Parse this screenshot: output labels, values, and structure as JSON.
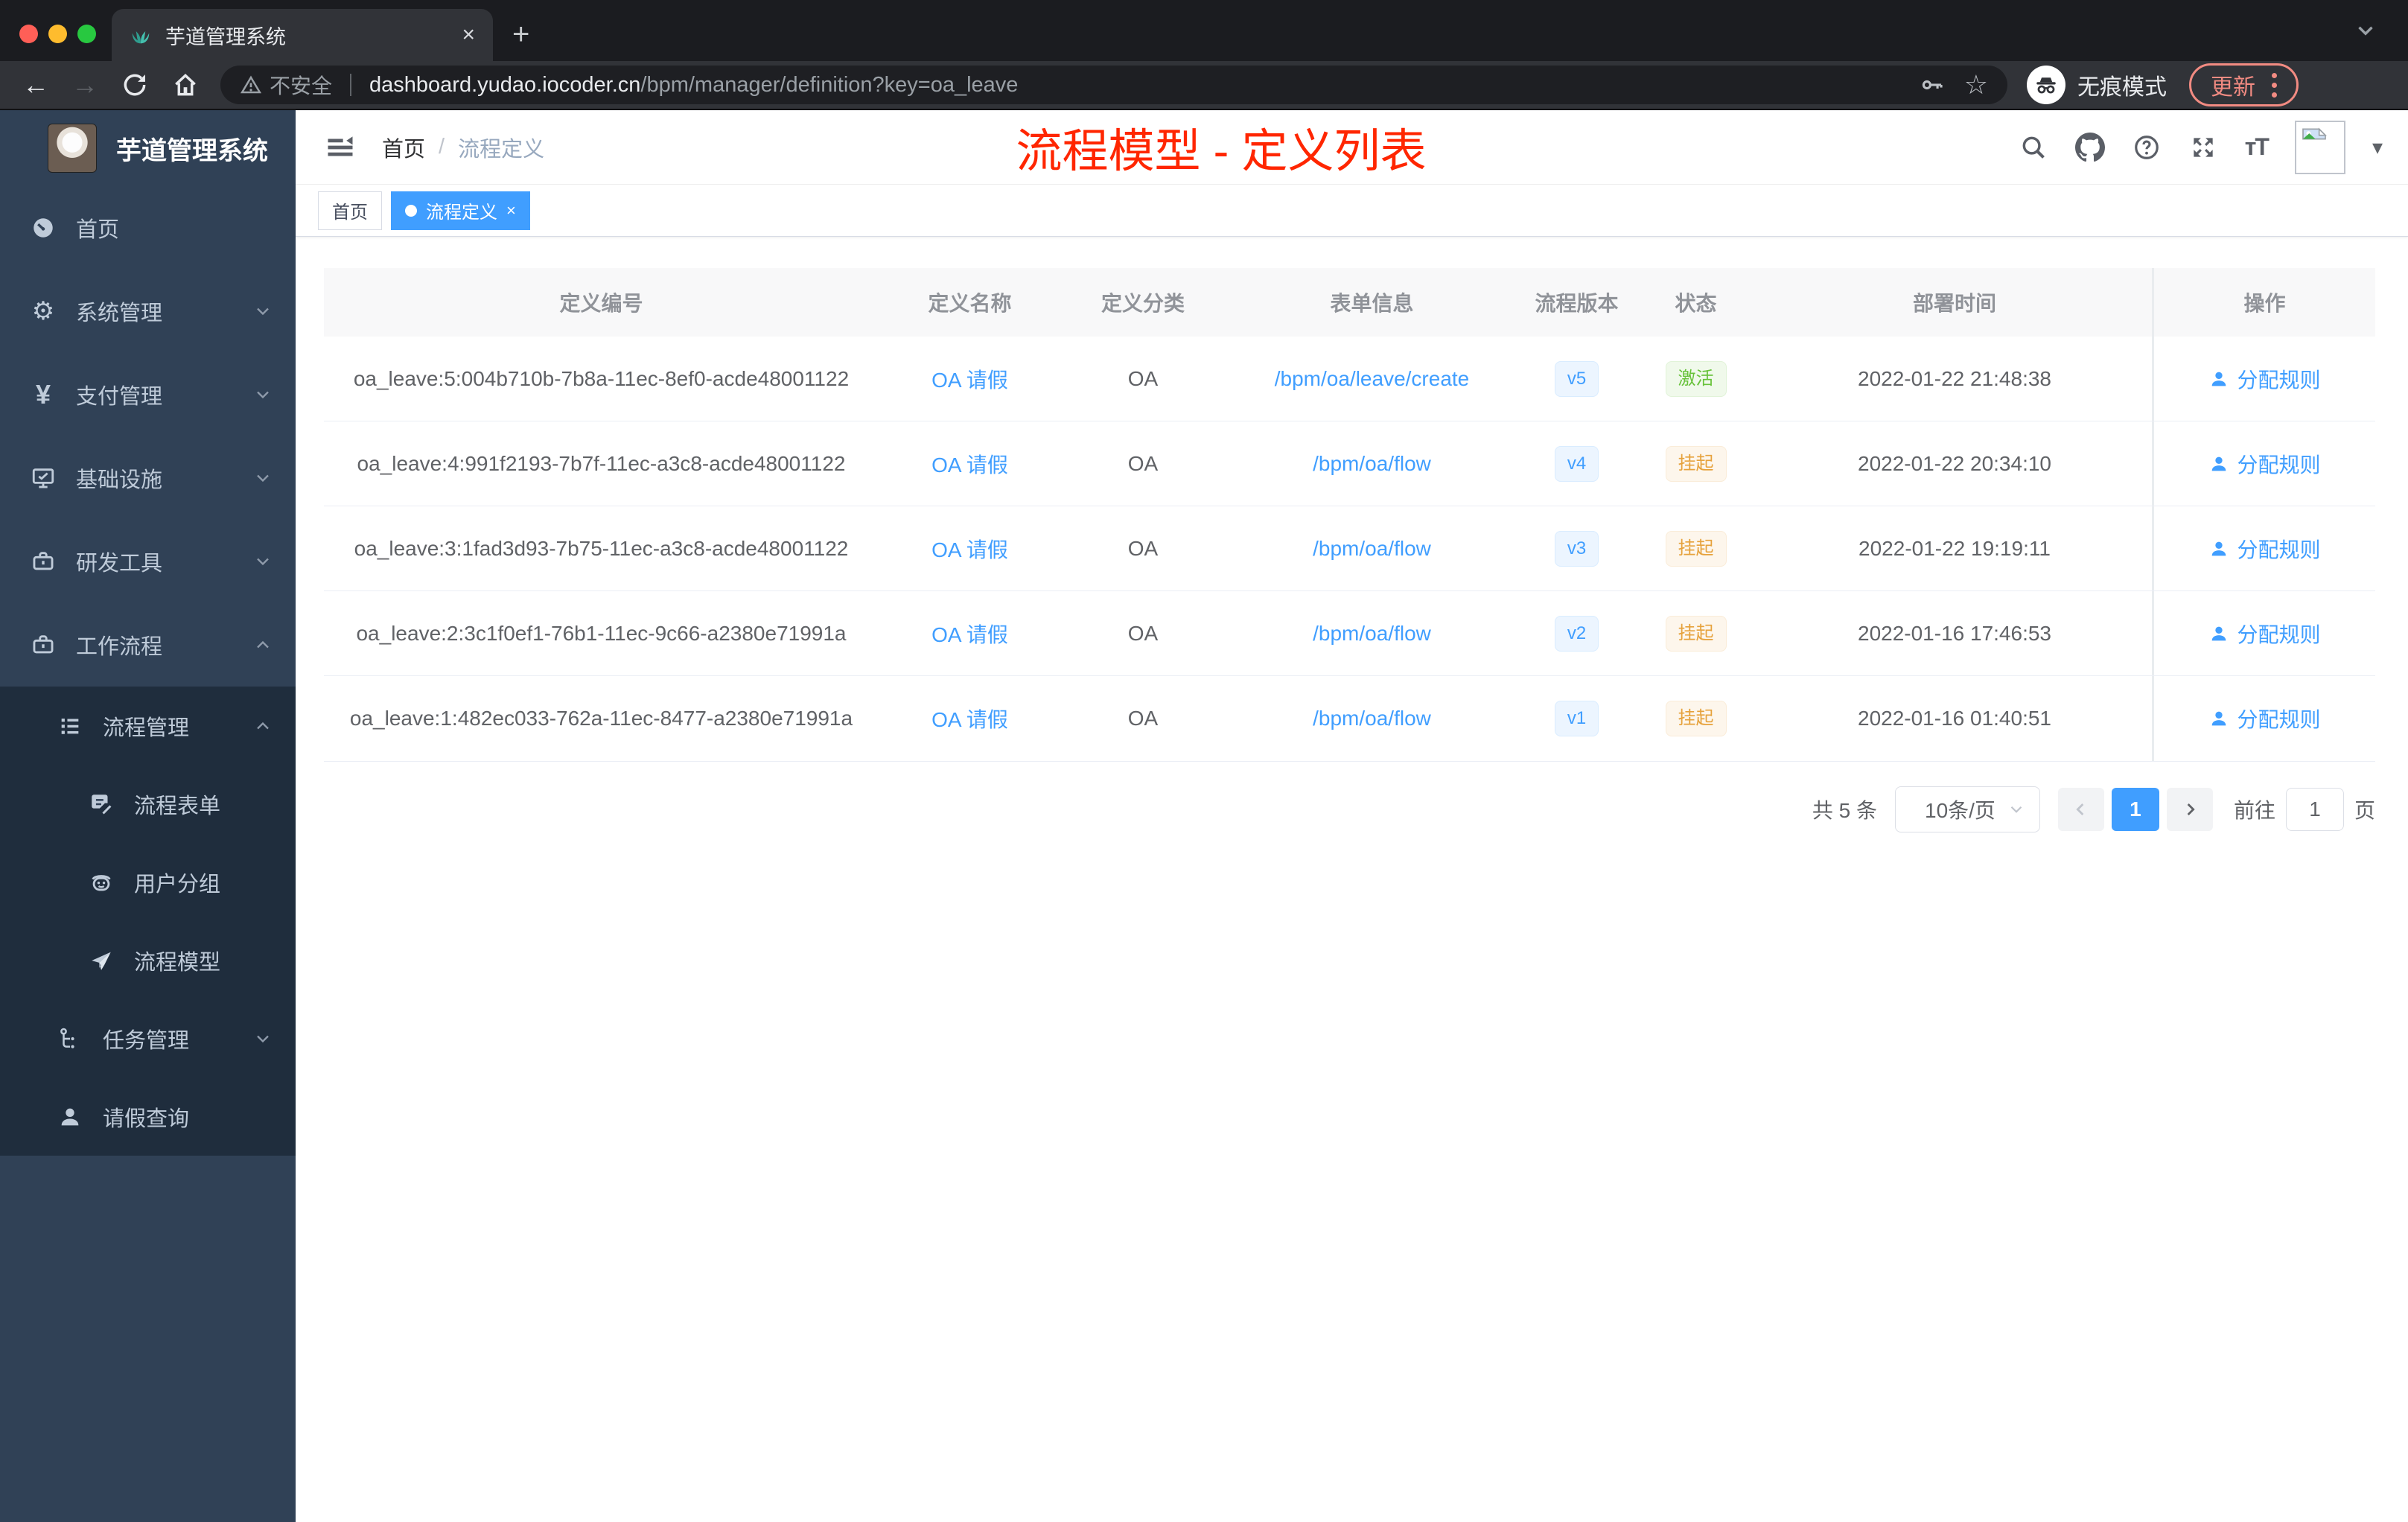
{
  "browser": {
    "tab": {
      "title": "芋道管理系统",
      "close": "×",
      "new_tab": "+"
    },
    "address": {
      "security": "不安全",
      "host": "dashboard.yudao.iocoder.cn",
      "path": "/bpm/manager/definition?key=oa_leave"
    },
    "incognito_label": "无痕模式",
    "update_label": "更新"
  },
  "sidebar": {
    "app_title": "芋道管理系统",
    "items": [
      {
        "label": "首页",
        "icon": "dashboard-icon"
      },
      {
        "label": "系统管理",
        "icon": "gear-icon",
        "chevron": "down"
      },
      {
        "label": "支付管理",
        "icon": "yen-icon",
        "chevron": "down"
      },
      {
        "label": "基础设施",
        "icon": "monitor-icon",
        "chevron": "down"
      },
      {
        "label": "研发工具",
        "icon": "toolbox-icon",
        "chevron": "down"
      },
      {
        "label": "工作流程",
        "icon": "workflow-icon",
        "chevron": "up"
      },
      {
        "label": "流程管理",
        "icon": "list-icon",
        "chevron": "up"
      },
      {
        "label": "流程表单",
        "icon": "form-icon"
      },
      {
        "label": "用户分组",
        "icon": "user-group-icon"
      },
      {
        "label": "流程模型",
        "icon": "paper-plane-icon"
      },
      {
        "label": "任务管理",
        "icon": "task-tree-icon",
        "chevron": "down"
      },
      {
        "label": "请假查询",
        "icon": "person-icon"
      }
    ]
  },
  "header": {
    "breadcrumb": {
      "home": "首页",
      "separator": "/",
      "current": "流程定义"
    },
    "annotation": "流程模型 - 定义列表"
  },
  "tags": {
    "home": "首页",
    "active": "流程定义",
    "close": "×"
  },
  "table": {
    "columns": [
      "定义编号",
      "定义名称",
      "定义分类",
      "表单信息",
      "流程版本",
      "状态",
      "部署时间",
      "操作"
    ],
    "action_label": "分配规则",
    "rows": [
      {
        "id": "oa_leave:5:004b710b-7b8a-11ec-8ef0-acde48001122",
        "name": "OA 请假",
        "category": "OA",
        "form": "/bpm/oa/leave/create",
        "version": "v5",
        "status": "激活",
        "status_type": "success",
        "deploy_time": "2022-01-22 21:48:38"
      },
      {
        "id": "oa_leave:4:991f2193-7b7f-11ec-a3c8-acde48001122",
        "name": "OA 请假",
        "category": "OA",
        "form": "/bpm/oa/flow",
        "version": "v4",
        "status": "挂起",
        "status_type": "warning",
        "deploy_time": "2022-01-22 20:34:10"
      },
      {
        "id": "oa_leave:3:1fad3d93-7b75-11ec-a3c8-acde48001122",
        "name": "OA 请假",
        "category": "OA",
        "form": "/bpm/oa/flow",
        "version": "v3",
        "status": "挂起",
        "status_type": "warning",
        "deploy_time": "2022-01-22 19:19:11"
      },
      {
        "id": "oa_leave:2:3c1f0ef1-76b1-11ec-9c66-a2380e71991a",
        "name": "OA 请假",
        "category": "OA",
        "form": "/bpm/oa/flow",
        "version": "v2",
        "status": "挂起",
        "status_type": "warning",
        "deploy_time": "2022-01-16 17:46:53"
      },
      {
        "id": "oa_leave:1:482ec033-762a-11ec-8477-a2380e71991a",
        "name": "OA 请假",
        "category": "OA",
        "form": "/bpm/oa/flow",
        "version": "v1",
        "status": "挂起",
        "status_type": "warning",
        "deploy_time": "2022-01-16 01:40:51"
      }
    ]
  },
  "pagination": {
    "total": "共 5 条",
    "page_size": "10条/页",
    "page": "1",
    "goto": "前往",
    "goto_value": "1",
    "unit": "页"
  },
  "colors": {
    "primary": "#409EFF",
    "success": "#67C23A",
    "warning": "#E6A23C",
    "annotation": "#FF2600",
    "sidebar_bg": "#304156",
    "submenu_bg": "#1F2D3D"
  }
}
